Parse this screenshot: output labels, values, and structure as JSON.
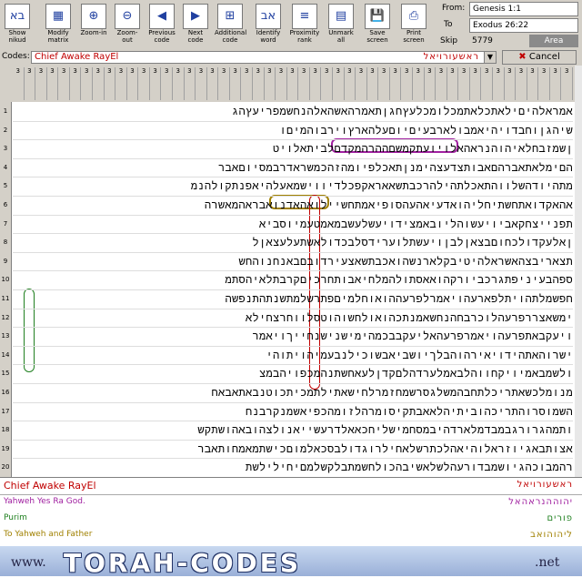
{
  "toolbar": {
    "buttons": [
      {
        "label": "Show nikud",
        "glyph": "בא"
      },
      {
        "label": "Modify matrix",
        "glyph": "▦"
      },
      {
        "label": "Zoom-in",
        "glyph": "⊕"
      },
      {
        "label": "Zoom-out",
        "glyph": "⊖"
      },
      {
        "label": "Previous code",
        "glyph": "◀"
      },
      {
        "label": "Next code",
        "glyph": "▶"
      },
      {
        "label": "Additional code",
        "glyph": "⊞"
      },
      {
        "label": "Identify word",
        "glyph": "אב"
      },
      {
        "label": "Proximity rank",
        "glyph": "≡"
      },
      {
        "label": "Unmark all",
        "glyph": "▤"
      },
      {
        "label": "Save screen",
        "glyph": "💾"
      },
      {
        "label": "Print screen",
        "glyph": "⎙"
      }
    ],
    "from_label": "From:",
    "from_value": "Genesis 1:1",
    "to_label": "To",
    "to_value": "Exodus 26:22",
    "skip_label": "Skip",
    "skip_value": "5779",
    "area_label": "Area"
  },
  "codes": {
    "label": "Codes:",
    "value": "Chief Awake RayEl",
    "hebrew": "ראשעורויאל",
    "cancel_label": "Cancel"
  },
  "column_headers": [
    "3",
    "3",
    "3",
    "3",
    "3",
    "3",
    "3",
    "3",
    "3",
    "3",
    "3",
    "3",
    "3",
    "3",
    "3",
    "3",
    "3",
    "3",
    "3",
    "3",
    "3",
    "3",
    "3",
    "3",
    "3",
    "3",
    "3",
    "3",
    "3",
    "3",
    "3",
    "3",
    "3",
    "3",
    "3",
    "3",
    "3",
    "3",
    "3",
    "3",
    "3",
    "3",
    "3",
    "3",
    "3",
    "3",
    "3",
    "3",
    "3"
  ],
  "grid_rows": [
    {
      "num": "1",
      "text": "אמראלהיםילאתכלאתמכלומכלעץחגןתאמרהאשהאלהנחשמפריעץהג"
    },
    {
      "num": "2",
      "text": "שיהגןוחבדויהיאמבולארבעיםיוםעלהארץוירבוהמיםו"
    },
    {
      "num": "3",
      "text": "ןשמזבחלאיהוהנראהאלויועתקמשםההרהמקדםלביתאלויט"
    },
    {
      "num": "4",
      "text": "הםימלאתאברהםאבותצדעצהימנןתאכלפיומהזהכמשראדרבמסיוםאבר"
    },
    {
      "num": "5",
      "text": "מתהיודהשלווהתאכלתהילהרכבתשאאראקפכלדיווישמאעלהיאפנתקולהנמ"
    },
    {
      "num": "6",
      "text": "אהאקדואתחשתיחליהואדעיאהעהסופיאמתחשיילואהאדנואבראהמאשרה"
    },
    {
      "num": "7",
      "text": "תפנייצחקאביויעשוהליובאמצידויעשלעשבמאמטעמיוסביא"
    },
    {
      "num": "8",
      "text": "ןאלעקדולכחוםבצאןלבןויעשתלוערידסלבכדולאשתעלעצאןל"
    },
    {
      "num": "9",
      "text": "תצאריבצהאשראלהיטיבקלארנשהואכבתשאצעירדובםבאנחנוהחש"
    },
    {
      "num": "10",
      "text": "ספהבעיניפתגרכביורקהואאסתולהמלחיאבותחרכיםקרבתלאיהסתמ"
    },
    {
      "num": "11",
      "text": "חפשמלתהויתלפארעהויאמרלפרעההואוחלמיםפתרשלמתשנתהתנפשה"
    },
    {
      "num": "12",
      "text": "ימשאצררפרעהלוכרבחהנחשאמנתכהואולחשוהוטסלווחרצחילא"
    },
    {
      "num": "13",
      "text": "ויעקבאתפרעהויאמרפרעהאליעקבבכמהימישנישנחייךויאמר"
    },
    {
      "num": "14",
      "text": "ישרוהאתהידויאירהוהבלךיושביאבשוכילנבעמיהויתוהי"
    },
    {
      "num": "15",
      "text": "ולשמבאמיויקחווהלבאמלערדהלםקדןלעאחשתנהמכפויהבמצ"
    },
    {
      "num": "16",
      "text": "מנומלכשאתריכלתחבהמשלגסרשמחזמרלחישאתילתמכיתכוטנבאתאבאח"
    },
    {
      "num": "17",
      "text": "השמוסרוהתריכהוביתיהלאאבתקיסומרהלזומהכפיאשמנקרבנח"
    },
    {
      "num": "18",
      "text": "ותמהגרורגבמבדמלארדהיבמסחמישליחכאאלדרעשייאנולצהובאהושתקש"
    },
    {
      "num": "19",
      "text": "אצותבאגיוזראלוהיאהלכתרשלאחילרוגדולבסכאלמוםכישתמאמחותאבר"
    },
    {
      "num": "20",
      "text": "רהמבוכהגיושמבדורעהלשלאשיבהכולחשמתבלקשלמםיחילילשת"
    }
  ],
  "found_codes": [
    {
      "label": "Chief Awake RayEl",
      "hebrew": "ראשעורויאל",
      "color": "#c00000"
    },
    {
      "label": "Yahweh Yes Ra God.",
      "hebrew": "יהוההנראהאל",
      "color": "#a020a0"
    },
    {
      "label": "Purim",
      "hebrew": "פורים",
      "color": "#208020"
    },
    {
      "label": "To Yahweh and Father",
      "hebrew": "ליהוהואב",
      "color": "#a08000"
    }
  ],
  "banner": {
    "www": "www.",
    "title": "TORAH-CODES",
    "tld": ".net"
  },
  "colors": {
    "toolbar_bg": "#d4d0c8",
    "code_red": "#c00000",
    "code_purple": "#a020a0",
    "code_green": "#208020",
    "code_gold": "#a08000"
  }
}
